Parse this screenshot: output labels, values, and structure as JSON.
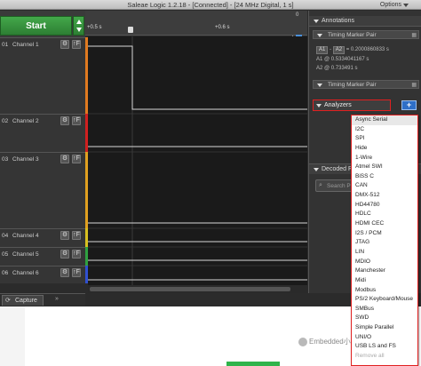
{
  "window": {
    "title": "Saleae Logic 1.2.18 - [Connected] - [24 MHz Digital, 1 s]",
    "options_label": "Options"
  },
  "start_button": {
    "label": "Start"
  },
  "channels": [
    {
      "num": "01",
      "name": "Channel 1",
      "color": "#e07a20"
    },
    {
      "num": "02",
      "name": "Channel 2",
      "color": "#d02020"
    },
    {
      "num": "03",
      "name": "Channel 3",
      "color": "#e0a020"
    },
    {
      "num": "04",
      "name": "Channel 4",
      "color": "#d8c020"
    },
    {
      "num": "05",
      "name": "Channel 5",
      "color": "#2fa040"
    },
    {
      "num": "06",
      "name": "Channel 6",
      "color": "#3050d0"
    }
  ],
  "channel_icons": {
    "gear": "⚙",
    "trigger": "↑F"
  },
  "capture_tab": {
    "label": "Capture",
    "more": "»"
  },
  "ruler": {
    "left_time": "+0.5 s",
    "right_time": "+0.6 s",
    "zoom": "0"
  },
  "annotations": {
    "header": "Annotations",
    "timing_pair_1": {
      "label": "Timing Marker Pair",
      "chip_a1": "A1",
      "chip_a2": "A2",
      "diff": "= 0.2000860833 s",
      "a1_value": "A1 @ 0.5334041167 s",
      "a2_value": "A2 @ 0.733491 s"
    },
    "timing_pair_2": {
      "label": "Timing Marker Pair"
    }
  },
  "analyzers": {
    "header": "Analyzers",
    "add_label": "+",
    "options": [
      "Async Serial",
      "I2C",
      "SPI",
      "Hide",
      "1-Wire",
      "Atmel SWI",
      "BiSS C",
      "CAN",
      "DMX-512",
      "HD44780",
      "HDLC",
      "HDMI CEC",
      "I2S / PCM",
      "JTAG",
      "LIN",
      "MDIO",
      "Manchester",
      "Midi",
      "Modbus",
      "PS/2 Keyboard/Mouse",
      "SMBus",
      "SWD",
      "Simple Parallel",
      "UNI/O",
      "USB LS and FS",
      "Remove all"
    ]
  },
  "decoded": {
    "header": "Decoded Pr",
    "search_placeholder": "Search P"
  },
  "watermark": "Embedded小飞哥"
}
